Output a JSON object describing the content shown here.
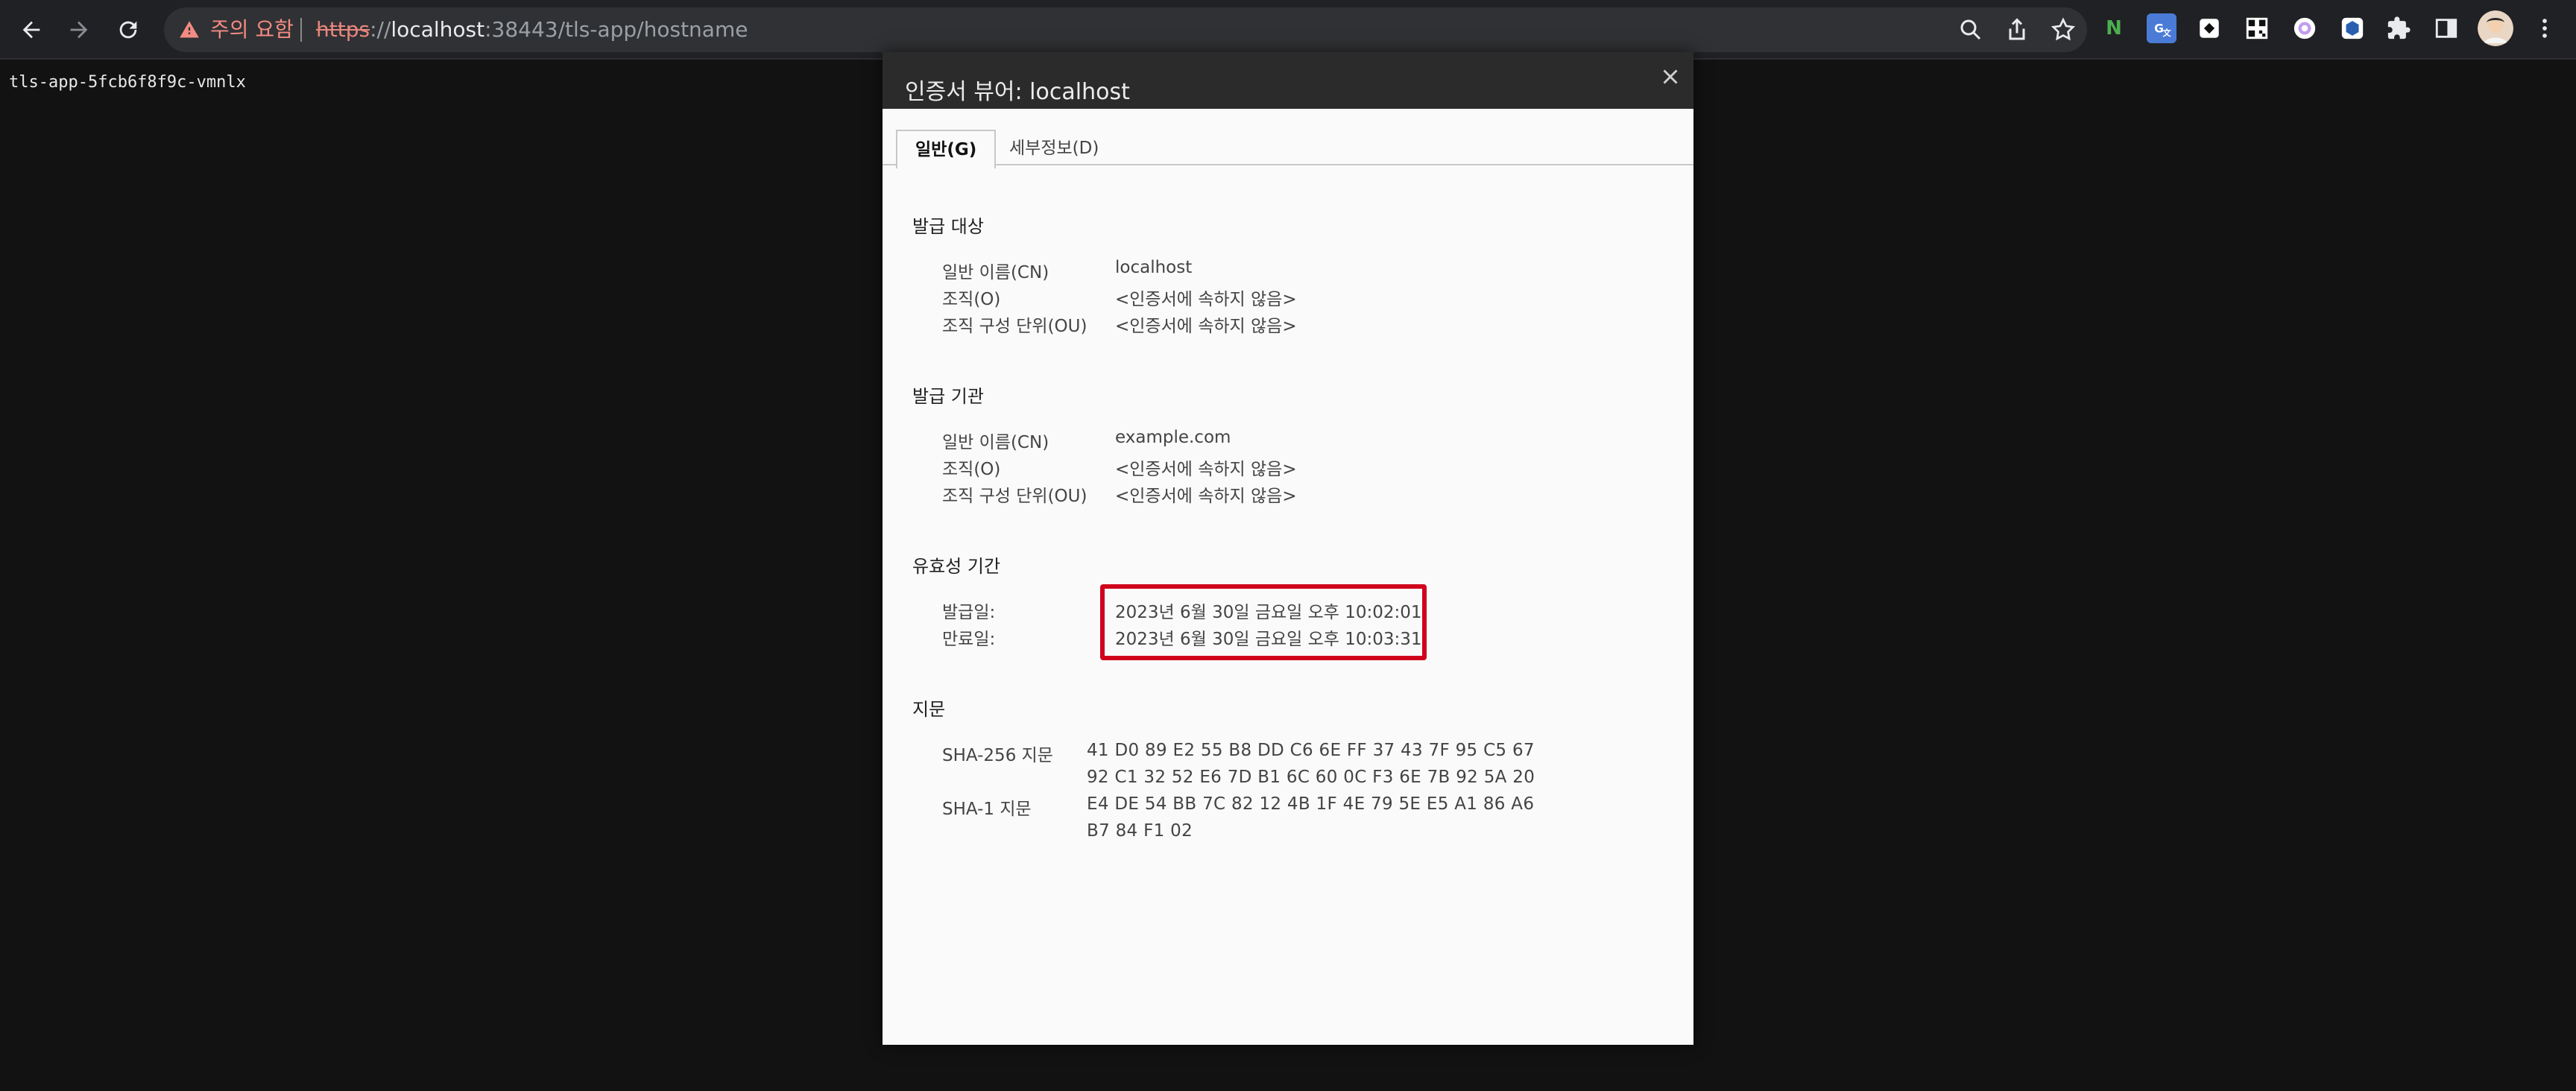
{
  "browser": {
    "security_warning": "주의 요함",
    "url_scheme": "https",
    "url_sep": "://",
    "url_host": "localhost",
    "url_rest": ":38443/tls-app/hostname",
    "icons": [
      "back-arrow-icon",
      "forward-arrow-icon",
      "reload-icon",
      "warning-triangle-icon",
      "zoom-icon",
      "share-icon",
      "star-icon",
      "extension-n-icon",
      "translate-icon",
      "extension-icon",
      "qr-icon",
      "extension-circle-icon",
      "extension-hex-icon",
      "puzzle-icon",
      "sidepanel-icon",
      "avatar",
      "kebab-menu-icon"
    ],
    "colors": {
      "warning": "#f28b82",
      "bar": "#202124",
      "omnibox": "#303134"
    }
  },
  "page": {
    "hostname_text": "tls-app-5fcb6f8f9c-vmnlx"
  },
  "dialog": {
    "title": "인증서 뷰어: localhost",
    "tabs": [
      {
        "label": "일반(G)",
        "active": true
      },
      {
        "label": "세부정보(D)",
        "active": false
      }
    ],
    "issued_to": {
      "heading": "발급 대상",
      "rows": [
        {
          "label": "일반 이름(CN)",
          "value": "localhost"
        },
        {
          "label": "조직(O)",
          "value": "<인증서에 속하지 않음>"
        },
        {
          "label": "조직 구성 단위(OU)",
          "value": "<인증서에 속하지 않음>"
        }
      ]
    },
    "issued_by": {
      "heading": "발급 기관",
      "rows": [
        {
          "label": "일반 이름(CN)",
          "value": "example.com"
        },
        {
          "label": "조직(O)",
          "value": "<인증서에 속하지 않음>"
        },
        {
          "label": "조직 구성 단위(OU)",
          "value": "<인증서에 속하지 않음>"
        }
      ]
    },
    "validity": {
      "heading": "유효성 기간",
      "rows": [
        {
          "label": "발급일:",
          "value": "2023년 6월 30일 금요일 오후 10:02:01"
        },
        {
          "label": "만료일:",
          "value": "2023년 6월 30일 금요일 오후 10:03:31"
        }
      ],
      "highlight_color": "#d0021b"
    },
    "fingerprints": {
      "heading": "지문",
      "sha256_label": "SHA-256 지문",
      "sha256_lines": [
        "41 D0 89 E2 55 B8 DD C6 6E FF 37 43 7F 95 C5 67",
        "92 C1 32 52 E6 7D B1 6C 60 0C F3 6E 7B 92 5A 20"
      ],
      "sha1_label": "SHA-1 지문",
      "sha1_lines": [
        "E4 DE 54 BB 7C 82 12 4B 1F 4E 79 5E E5 A1 86 A6",
        "B7 84 F1 02"
      ]
    }
  }
}
